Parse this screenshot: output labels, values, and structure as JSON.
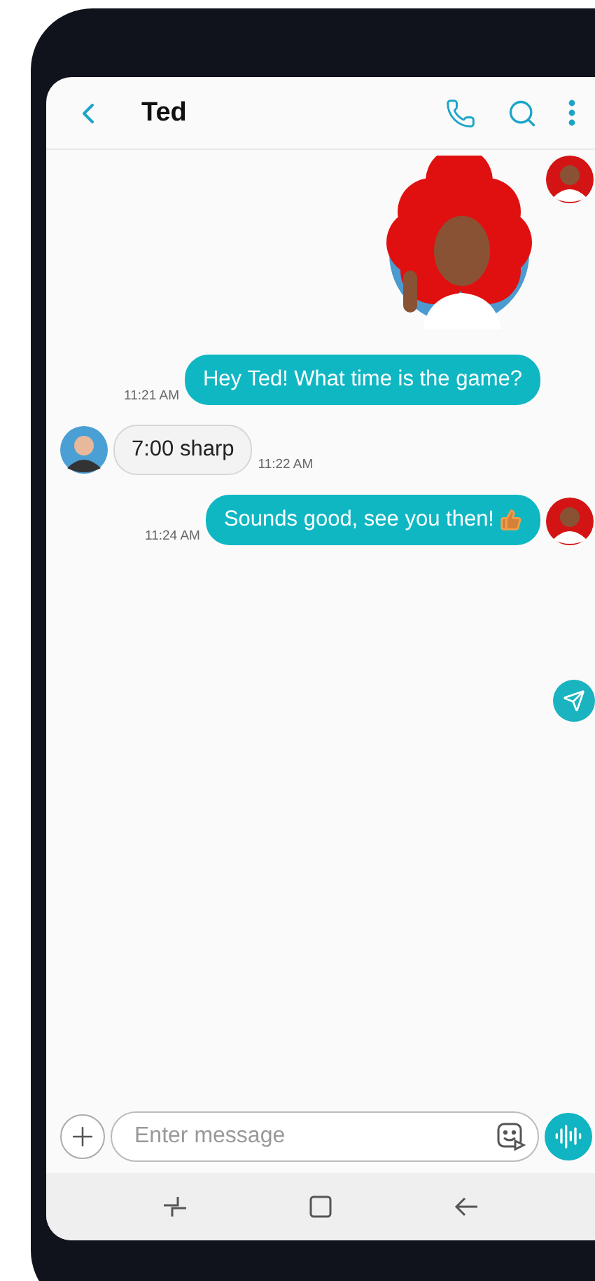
{
  "header": {
    "title": "Ted"
  },
  "messages": [
    {
      "kind": "sticker",
      "outgoing": true,
      "show_avatar": true
    },
    {
      "kind": "text",
      "outgoing": true,
      "text": "Hey Ted! What time is the game?",
      "time": "11:21 AM",
      "show_avatar": false
    },
    {
      "kind": "text",
      "outgoing": false,
      "text": "7:00 sharp",
      "time": "11:22 AM",
      "show_avatar": true
    },
    {
      "kind": "text",
      "outgoing": true,
      "text": "Sounds good, see you then!",
      "time": "11:24 AM",
      "show_avatar": true,
      "thumbs_up": true
    }
  ],
  "composer": {
    "placeholder": "Enter message"
  }
}
